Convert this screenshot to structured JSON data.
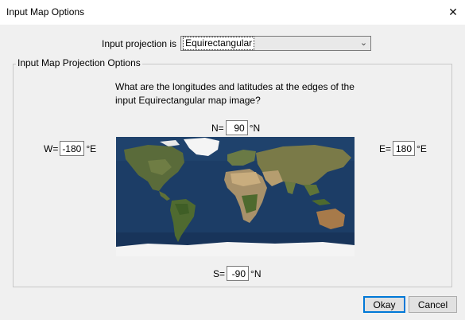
{
  "window": {
    "title": "Input Map Options",
    "close_glyph": "✕"
  },
  "projection": {
    "label": "Input projection is",
    "selected": "Equirectangular"
  },
  "group": {
    "label": "Input Map Projection Options",
    "question": "What are the longitudes and latitudes at the edges of the input Equirectangular map image?"
  },
  "north": {
    "label": "N=",
    "value": "90",
    "unit": "°N"
  },
  "south": {
    "label": "S=",
    "value": "-90",
    "unit": "°N"
  },
  "west": {
    "label": "W=",
    "value": "-180",
    "unit": "°E"
  },
  "east": {
    "label": "E=",
    "value": "180",
    "unit": "°E"
  },
  "buttons": {
    "ok": "Okay",
    "cancel": "Cancel"
  },
  "colors": {
    "ocean": "#1c3d66",
    "land": "#5a6b3a",
    "ice": "#f4f4f4",
    "accent": "#0078d7"
  }
}
